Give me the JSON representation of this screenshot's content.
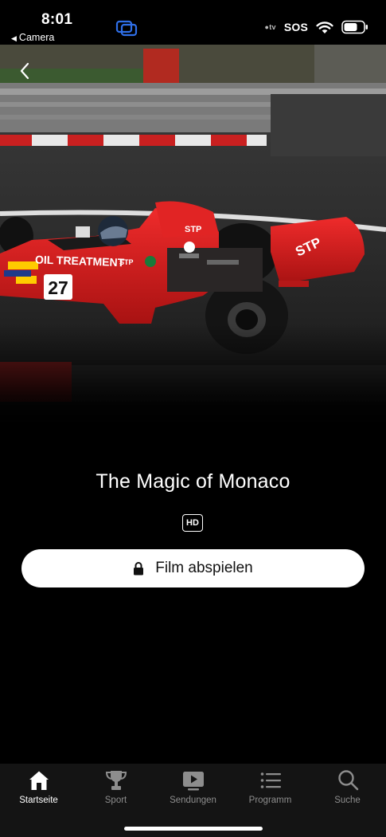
{
  "status_bar": {
    "time": "8:01",
    "back_app": "Camera",
    "appletv": "tv",
    "sos": "SOS"
  },
  "hero": {
    "car_number": "27",
    "sponsor_text": "OIL TREATMENT",
    "sponsor_logo": "STP"
  },
  "content": {
    "title": "The Magic of Monaco",
    "quality_badge": "HD",
    "play_label": "Film abspielen"
  },
  "tab_bar": {
    "tabs": [
      {
        "label": "Startseite",
        "icon": "home-icon",
        "active": true
      },
      {
        "label": "Sport",
        "icon": "trophy-icon",
        "active": false
      },
      {
        "label": "Sendungen",
        "icon": "play-screen-icon",
        "active": false
      },
      {
        "label": "Programm",
        "icon": "list-icon",
        "active": false
      },
      {
        "label": "Suche",
        "icon": "search-icon",
        "active": false
      }
    ]
  },
  "colors": {
    "background": "#000000",
    "car_red": "#d81e1e",
    "tab_bar_bg": "#141414",
    "inactive_tab": "#8d8d8d"
  }
}
